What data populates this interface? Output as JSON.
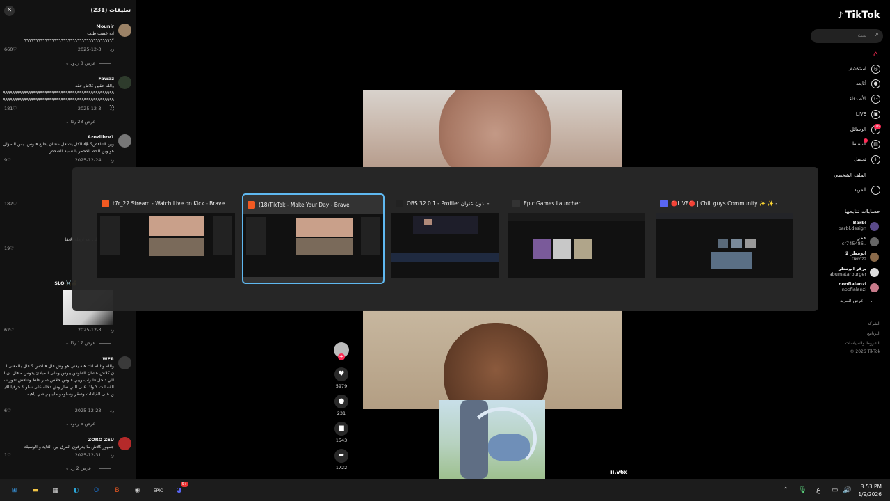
{
  "comments_panel": {
    "title": "تعليقات (231)",
    "comments": [
      {
        "name": "Mounir",
        "text": "ايه عصب طيب\n؟٩٩٩٩٩٩٩٩٩٩٩٩٩٩٩٩٩٩٩٩٩٩٩٩٩٩٩٩٩٩٩٩٩٩٩٩٩٩",
        "date": "2025-12-3",
        "reply_label": "رد",
        "likes": "660",
        "replies_label": "عرض 8 ردود",
        "avatar_color": "#9b8266"
      },
      {
        "name": "Fawaz",
        "text": "والله حقين كلاش حقه\n٩٩٩٩٩٩٩٩٩٩٩٩٩٩٩٩٩٩٩٩٩٩٩٩٩٩٩٩٩٩٩٩٩٩٩٩٩٩٩٩٩٩٩٩٩٩٩٩٩٩٩٩٩٩٩٩٩٩٩٩٩٩٩٩٩٩٩٩٩٩٩٩٩٩٩٩٩٩٩٩٩٩٩٩٩٩٩٩٩٩٩٩٩٩٩٩٩٩",
        "date": "2025-12-3",
        "reply_label": "رد",
        "likes": "181",
        "replies_label": "عرض 23 ردًا",
        "avatar_color": "#2e3b2c"
      },
      {
        "name": "Azozlibre1",
        "text": "وين التناقض؟ 😂 الكل يشتغل عشان يطلع فلوس. بس السؤال هو وين الخط الاحمر بالنسبة للشخص.",
        "date": "2025-12-24",
        "reply_label": "رد",
        "likes": "9",
        "avatar_color": "#777"
      },
      {
        "name": "WER",
        "text": "والله وتالله انك هبه يعني هو وش قال فالدس ؟ قال بالمعنى ان كلاش عشان الفلوس يبوس وعلى المبادئ يدوس مافال ان اللي داخل فالراب ويبي فلوس خلاص صار غلط وتناقض تدور سالفه انت ؟ واذا على اللي صار وش دخله على سلو ؟ حرفيا الاين على القيادات وصقر وسلومو ماببنهم شي ياهبه",
        "date": "2025-12-23",
        "reply_label": "رد",
        "likes": "6",
        "replies_label": "عرض 5 ردود",
        "avatar_color": "#3a3a3a"
      },
      {
        "name": "ZORO ZEU",
        "text": "جمهور كلاش ما يعرفون الفرق بين الغاية و الوسيلة",
        "date": "2025-12-31",
        "reply_label": "رد",
        "likes": "1",
        "replies_label": "عرض 2 رد",
        "avatar_color": "#b52a2a"
      }
    ],
    "partial": [
      {
        "likes": "182"
      },
      {
        "text": "وانا ما عرفته الى بعد ارملة الاتقا",
        "likes": "19"
      },
      {
        "name": "SLO",
        "date": "2025-12-3",
        "reply_label": "رد",
        "likes": "62",
        "replies_label": "عرض 17 ردًا"
      }
    ]
  },
  "video": {
    "username": "ii.v6x",
    "actions": [
      {
        "icon": "heart-icon",
        "glyph": "♥",
        "count": "5979"
      },
      {
        "icon": "comment-icon",
        "glyph": "●",
        "count": "231"
      },
      {
        "icon": "bookmark-icon",
        "glyph": "■",
        "count": "1543"
      },
      {
        "icon": "share-icon",
        "glyph": "➦",
        "count": "1722"
      }
    ]
  },
  "tiktok": {
    "brand": "TikTok",
    "search_placeholder": "بحث",
    "nav": [
      {
        "label": "",
        "icon": "home-icon",
        "glyph": "⌂"
      },
      {
        "label": "استكشف",
        "icon": "compass-icon",
        "glyph": "◎"
      },
      {
        "label": "أتابعه",
        "icon": "avatar-icon",
        "glyph": "●"
      },
      {
        "label": "الأصدقاء",
        "icon": "friends-icon",
        "glyph": "⚇"
      },
      {
        "label": "LIVE",
        "icon": "live-icon",
        "glyph": "▣"
      },
      {
        "label": "الرسائل",
        "icon": "messages-icon",
        "glyph": "✈",
        "badge": "16"
      },
      {
        "label": "النشاط",
        "icon": "activity-icon",
        "glyph": "▤",
        "dot": true
      },
      {
        "label": "تحميل",
        "icon": "upload-icon",
        "glyph": "+"
      },
      {
        "label": "الملف الشخصي",
        "icon": "profile-icon",
        "glyph": ""
      },
      {
        "label": "المزيد",
        "icon": "more-icon",
        "glyph": "…"
      }
    ],
    "following_header": "حسابات تتابعها",
    "following": [
      {
        "name": "Barbl",
        "handle": "barbl.design",
        "color": "#5a4a8a"
      },
      {
        "name": "عمر",
        "handle": "cr745486..",
        "color": "#666"
      },
      {
        "name": "ابومطر 2",
        "handle": "0kmzz",
        "color": "#8a6a4a"
      },
      {
        "name": "برقر ابومطر",
        "handle": "abumatarburger",
        "color": "#ddd"
      },
      {
        "name": "noofialanzi",
        "handle": "noofialanzi",
        "color": "#c77a8a"
      }
    ],
    "see_more": "عرض المزيد",
    "footer": [
      "الشركة",
      "البرنامج",
      "الشروط والسياسات",
      "© 2026 TikTok"
    ]
  },
  "task_switcher": {
    "windows": [
      {
        "title": "t7r_22 Stream - Watch Live on Kick - Brave",
        "icon": "brave-icon",
        "icon_color": "#f25a22",
        "selected": false
      },
      {
        "title": "(18)TikTok - Make Your Day - Brave",
        "icon": "brave-icon",
        "icon_color": "#f25a22",
        "selected": true
      },
      {
        "title": "OBS 32.0.1 - Profile: بدون عنوان -...",
        "icon": "obs-icon",
        "icon_color": "#222",
        "selected": false
      },
      {
        "title": "Epic Games Launcher",
        "icon": "epic-icon",
        "icon_color": "#333",
        "selected": false
      },
      {
        "title": "🔴LIVE🔴 | Chill guys Community ✨ ✨ -...",
        "icon": "discord-icon",
        "icon_color": "#5865f2",
        "selected": false
      }
    ]
  },
  "taskbar": {
    "apps": [
      {
        "icon": "windows-start-icon",
        "glyph": "⊞",
        "color": "#3aa0f0"
      },
      {
        "icon": "file-explorer-icon",
        "glyph": "▬",
        "color": "#f3c545"
      },
      {
        "icon": "store-icon",
        "glyph": "▦",
        "color": "#ddd"
      },
      {
        "icon": "edge-icon",
        "glyph": "◐",
        "color": "#2ba5d8"
      },
      {
        "icon": "outlook-icon",
        "glyph": "O",
        "color": "#1b73d1"
      },
      {
        "icon": "brave-icon",
        "glyph": "B",
        "color": "#f25a22"
      },
      {
        "icon": "obs-icon",
        "glyph": "◉",
        "color": "#ccc"
      },
      {
        "icon": "epic-icon",
        "glyph": "EPIC",
        "color": "#eee"
      },
      {
        "icon": "discord-icon",
        "glyph": "◕",
        "color": "#5865f2",
        "badge": "9+"
      }
    ],
    "tray_lang": "ع",
    "time": "3:53 PM",
    "date": "1/9/2026"
  }
}
